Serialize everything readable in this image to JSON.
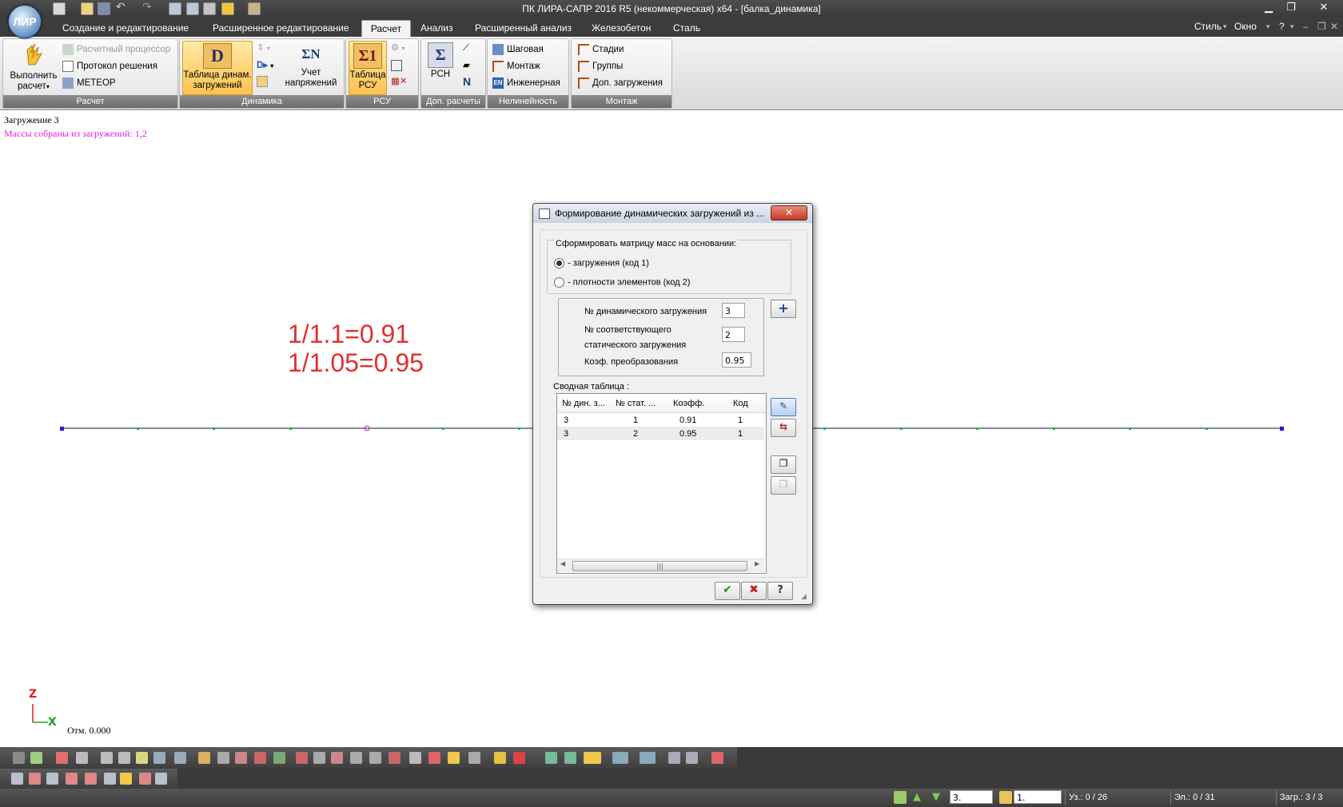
{
  "window": {
    "title": "ПК ЛИРА-САПР  2016 R5 (некоммерческая) x64 - [балка_динамика]",
    "app_logo_text": "ЛИР"
  },
  "tabs": [
    {
      "label": "Создание и редактирование"
    },
    {
      "label": "Расширенное редактирование"
    },
    {
      "label": "Расчет"
    },
    {
      "label": "Анализ"
    },
    {
      "label": "Расширенный анализ"
    },
    {
      "label": "Железобетон"
    },
    {
      "label": "Сталь"
    }
  ],
  "tabs_right": {
    "style": "Стиль",
    "window": "Окно",
    "help": "?"
  },
  "ribbon": {
    "calc": {
      "run_label_1": "Выполнить",
      "run_label_2": "расчет",
      "processor": "Расчетный процессор",
      "protocol": "Протокол решения",
      "meteor": "МЕТЕОР",
      "group": "Расчет"
    },
    "dynamics": {
      "table_label_1": "Таблица динам.",
      "table_label_2": "загружений",
      "stress_label_1": "Учет",
      "stress_label_2": "напряжений",
      "group": "Динамика"
    },
    "rsu": {
      "table_label_1": "Таблица",
      "table_label_2": "РСУ",
      "group": "РСУ"
    },
    "extra": {
      "rsn": "РСН",
      "group": "Доп. расчеты"
    },
    "nonlinear": {
      "step": "Шаговая",
      "montage": "Монтаж",
      "engineering": "Инженерная",
      "group": "Нелинейность"
    },
    "montage": {
      "stages": "Стадии",
      "groups": "Группы",
      "extra_loads": "Доп. загружения",
      "group": "Монтаж"
    }
  },
  "canvas": {
    "load_title": "Загружение 3",
    "masses_note": "Массы собраны из загружений:  1,2",
    "annotation_1": "1/1.1=0.91",
    "annotation_2": "1/1.05=0.95",
    "axis_z": "Z",
    "axis_x": "X",
    "elevation": "Отм. 0.000"
  },
  "dialog": {
    "title": "Формирование динамических загружений из ...",
    "mass_matrix_label": "Сформировать матрицу масс на основании:",
    "option_loads": "- загружения (код 1)",
    "option_density": "- плотности элементов (код 2)",
    "dyn_load_label": "№  динамического загружения",
    "dyn_load_value": "3",
    "static_label_1": "№ соответствующего",
    "static_label_2": "статического загружения",
    "static_value": "2",
    "coef_label": "Коэф. преобразования",
    "coef_value": "0.95",
    "summary_label": "Сводная таблица :",
    "columns": [
      "№ дин. з...",
      "№ стат. ...",
      "Коэфф.",
      "Код"
    ],
    "rows": [
      [
        "3",
        "1",
        "0.91",
        "1"
      ],
      [
        "3",
        "2",
        "0.95",
        "1"
      ]
    ]
  },
  "status": {
    "load_combo": "3.",
    "combo2": "1.",
    "nodes": "Уз.: 0 / 26",
    "elements": "Эл.: 0 / 31",
    "loads": "Загр.: 3 / 3"
  }
}
